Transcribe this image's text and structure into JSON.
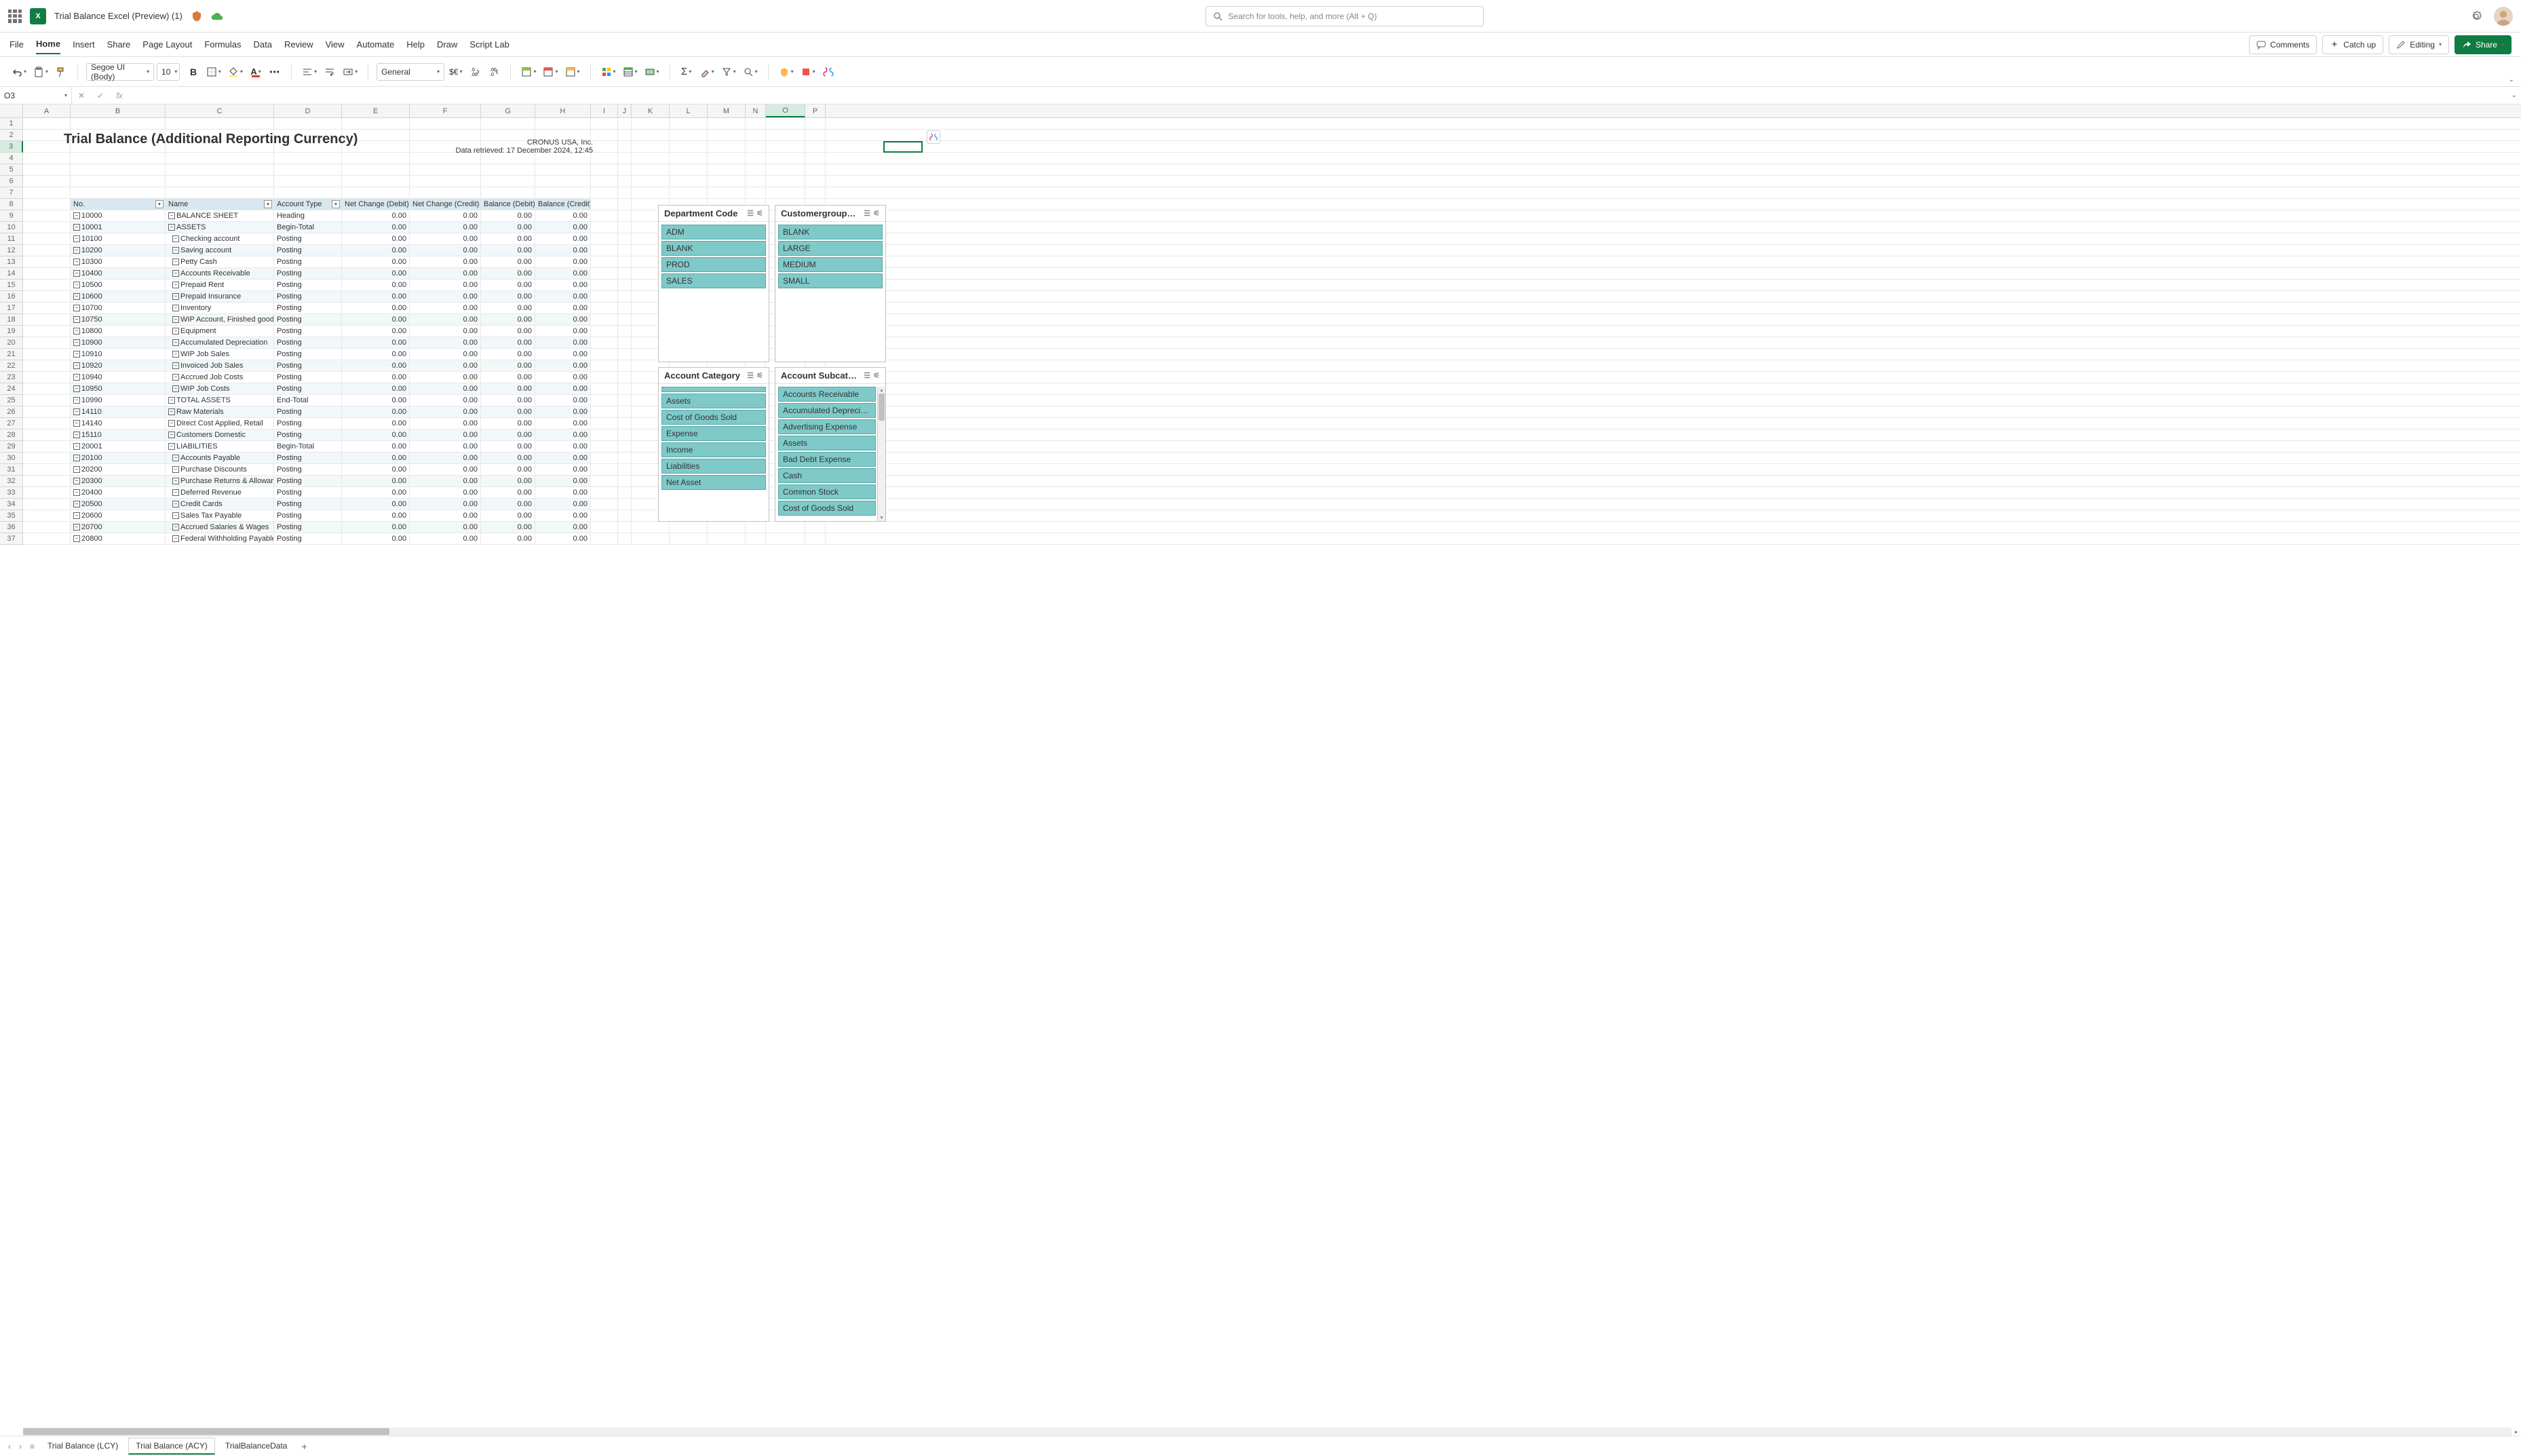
{
  "titlebar": {
    "doc_title": "Trial Balance Excel (Preview) (1)",
    "search_placeholder": "Search for tools, help, and more (Alt + Q)",
    "excel_badge": "X"
  },
  "menubar": {
    "tabs": [
      "File",
      "Home",
      "Insert",
      "Share",
      "Page Layout",
      "Formulas",
      "Data",
      "Review",
      "View",
      "Automate",
      "Help",
      "Draw",
      "Script Lab"
    ],
    "active_index": 1,
    "comments": "Comments",
    "catchup": "Catch up",
    "editing": "Editing",
    "share": "Share"
  },
  "ribbon": {
    "font_name": "Segoe UI (Body)",
    "font_size": "10",
    "number_format": "General"
  },
  "formulabar": {
    "namebox": "O3",
    "formula": ""
  },
  "columns": [
    "A",
    "B",
    "C",
    "D",
    "E",
    "F",
    "G",
    "H",
    "I",
    "J",
    "K",
    "L",
    "M",
    "N",
    "O",
    "P"
  ],
  "active_col_index": 14,
  "active_row": 3,
  "report": {
    "title": "Trial Balance (Additional Reporting Currency)",
    "company": "CRONUS USA, Inc.",
    "retrieved": "Data retrieved: 17 December 2024, 12:45"
  },
  "table": {
    "headers": [
      "No.",
      "Name",
      "Account Type",
      "Net Change (Debit)",
      "Net Change (Credit)",
      "Balance (Debit)",
      "Balance (Credit)"
    ],
    "rows": [
      {
        "no": "10000",
        "name": "BALANCE SHEET",
        "type": "Heading",
        "v": [
          "0.00",
          "0.00",
          "0.00",
          "0.00"
        ]
      },
      {
        "no": "10001",
        "name": "ASSETS",
        "type": "Begin-Total",
        "v": [
          "0.00",
          "0.00",
          "0.00",
          "0.00"
        ]
      },
      {
        "no": "10100",
        "name": "Checking account",
        "type": "Posting",
        "v": [
          "0.00",
          "0.00",
          "0.00",
          "0.00"
        ],
        "indent": true
      },
      {
        "no": "10200",
        "name": "Saving account",
        "type": "Posting",
        "v": [
          "0.00",
          "0.00",
          "0.00",
          "0.00"
        ],
        "indent": true
      },
      {
        "no": "10300",
        "name": "Petty Cash",
        "type": "Posting",
        "v": [
          "0.00",
          "0.00",
          "0.00",
          "0.00"
        ],
        "indent": true
      },
      {
        "no": "10400",
        "name": "Accounts Receivable",
        "type": "Posting",
        "v": [
          "0.00",
          "0.00",
          "0.00",
          "0.00"
        ],
        "indent": true
      },
      {
        "no": "10500",
        "name": "Prepaid Rent",
        "type": "Posting",
        "v": [
          "0.00",
          "0.00",
          "0.00",
          "0.00"
        ],
        "indent": true
      },
      {
        "no": "10600",
        "name": "Prepaid Insurance",
        "type": "Posting",
        "v": [
          "0.00",
          "0.00",
          "0.00",
          "0.00"
        ],
        "indent": true
      },
      {
        "no": "10700",
        "name": "Inventory",
        "type": "Posting",
        "v": [
          "0.00",
          "0.00",
          "0.00",
          "0.00"
        ],
        "indent": true
      },
      {
        "no": "10750",
        "name": "WIP Account, Finished goods",
        "type": "Posting",
        "v": [
          "0.00",
          "0.00",
          "0.00",
          "0.00"
        ],
        "indent": true
      },
      {
        "no": "10800",
        "name": "Equipment",
        "type": "Posting",
        "v": [
          "0.00",
          "0.00",
          "0.00",
          "0.00"
        ],
        "indent": true
      },
      {
        "no": "10900",
        "name": "Accumulated Depreciation",
        "type": "Posting",
        "v": [
          "0.00",
          "0.00",
          "0.00",
          "0.00"
        ],
        "indent": true
      },
      {
        "no": "10910",
        "name": "WIP Job Sales",
        "type": "Posting",
        "v": [
          "0.00",
          "0.00",
          "0.00",
          "0.00"
        ],
        "indent": true
      },
      {
        "no": "10920",
        "name": "Invoiced Job Sales",
        "type": "Posting",
        "v": [
          "0.00",
          "0.00",
          "0.00",
          "0.00"
        ],
        "indent": true
      },
      {
        "no": "10940",
        "name": "Accrued Job Costs",
        "type": "Posting",
        "v": [
          "0.00",
          "0.00",
          "0.00",
          "0.00"
        ],
        "indent": true
      },
      {
        "no": "10950",
        "name": "WIP Job Costs",
        "type": "Posting",
        "v": [
          "0.00",
          "0.00",
          "0.00",
          "0.00"
        ],
        "indent": true
      },
      {
        "no": "10990",
        "name": "TOTAL ASSETS",
        "type": "End-Total",
        "v": [
          "0.00",
          "0.00",
          "0.00",
          "0.00"
        ]
      },
      {
        "no": "14110",
        "name": "Raw Materials",
        "type": "Posting",
        "v": [
          "0.00",
          "0.00",
          "0.00",
          "0.00"
        ]
      },
      {
        "no": "14140",
        "name": "Direct Cost Applied, Retail",
        "type": "Posting",
        "v": [
          "0.00",
          "0.00",
          "0.00",
          "0.00"
        ]
      },
      {
        "no": "15110",
        "name": "Customers Domestic",
        "type": "Posting",
        "v": [
          "0.00",
          "0.00",
          "0.00",
          "0.00"
        ]
      },
      {
        "no": "20001",
        "name": "LIABILITIES",
        "type": "Begin-Total",
        "v": [
          "0.00",
          "0.00",
          "0.00",
          "0.00"
        ]
      },
      {
        "no": "20100",
        "name": "Accounts Payable",
        "type": "Posting",
        "v": [
          "0.00",
          "0.00",
          "0.00",
          "0.00"
        ],
        "indent": true
      },
      {
        "no": "20200",
        "name": "Purchase Discounts",
        "type": "Posting",
        "v": [
          "0.00",
          "0.00",
          "0.00",
          "0.00"
        ],
        "indent": true
      },
      {
        "no": "20300",
        "name": "Purchase Returns & Allowances",
        "type": "Posting",
        "v": [
          "0.00",
          "0.00",
          "0.00",
          "0.00"
        ],
        "indent": true
      },
      {
        "no": "20400",
        "name": "Deferred Revenue",
        "type": "Posting",
        "v": [
          "0.00",
          "0.00",
          "0.00",
          "0.00"
        ],
        "indent": true
      },
      {
        "no": "20500",
        "name": "Credit Cards",
        "type": "Posting",
        "v": [
          "0.00",
          "0.00",
          "0.00",
          "0.00"
        ],
        "indent": true
      },
      {
        "no": "20600",
        "name": "Sales Tax Payable",
        "type": "Posting",
        "v": [
          "0.00",
          "0.00",
          "0.00",
          "0.00"
        ],
        "indent": true
      },
      {
        "no": "20700",
        "name": "Accrued Salaries & Wages",
        "type": "Posting",
        "v": [
          "0.00",
          "0.00",
          "0.00",
          "0.00"
        ],
        "indent": true
      },
      {
        "no": "20800",
        "name": "Federal Withholding Payable",
        "type": "Posting",
        "v": [
          "0.00",
          "0.00",
          "0.00",
          "0.00"
        ],
        "indent": true
      }
    ]
  },
  "slicers": {
    "dept": {
      "title": "Department Code",
      "items": [
        "ADM",
        "BLANK",
        "PROD",
        "SALES"
      ]
    },
    "custgroup": {
      "title": "Customergroup…",
      "items": [
        "BLANK",
        "LARGE",
        "MEDIUM",
        "SMALL"
      ]
    },
    "acctcat": {
      "title": "Account Category",
      "items": [
        "",
        "Assets",
        "Cost of Goods Sold",
        "Expense",
        "Income",
        "Liabilities",
        "Net Asset"
      ]
    },
    "acctsub": {
      "title": "Account Subcat…",
      "items": [
        "Accounts Receivable",
        "Accumulated Depreci…",
        "Advertising Expense",
        "Assets",
        "Bad Debt Expense",
        "Cash",
        "Common Stock",
        "Cost of Goods Sold"
      ]
    }
  },
  "sheets": {
    "tabs": [
      "Trial Balance (LCY)",
      "Trial Balance (ACY)",
      "TrialBalanceData"
    ],
    "active_index": 1
  }
}
